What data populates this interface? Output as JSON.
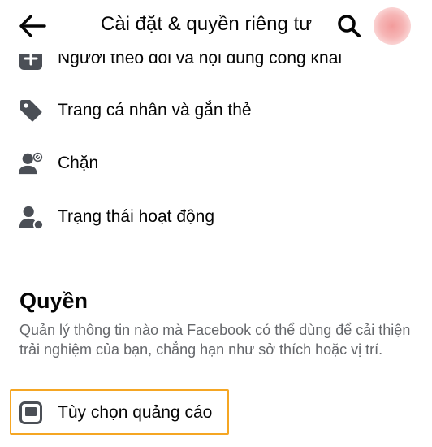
{
  "header": {
    "title": "Cài đặt & quyền riêng tư",
    "back_icon": "arrow-left-icon",
    "search_icon": "search-icon"
  },
  "list": {
    "items": [
      {
        "label": "Người theo dõi và nội dung công khai",
        "icon": "plus-square-icon"
      },
      {
        "label": "Trang cá nhân và gắn thẻ",
        "icon": "tag-icon"
      },
      {
        "label": "Chặn",
        "icon": "person-block-icon"
      },
      {
        "label": "Trạng thái hoạt động",
        "icon": "person-status-icon"
      }
    ]
  },
  "permissions": {
    "title": "Quyền",
    "description": "Quản lý thông tin nào mà Facebook có thể dùng để cải thiện trải nghiệm của bạn, chẳng hạn như sở thích hoặc vị trí.",
    "items": [
      {
        "label": "Tùy chọn quảng cáo",
        "icon": "ad-monitor-icon"
      }
    ]
  },
  "colors": {
    "icon": "#4b4f56",
    "text": "#050505",
    "secondary_text": "#65676b",
    "highlight_border": "#f5a623",
    "divider": "#dfe1e5"
  }
}
